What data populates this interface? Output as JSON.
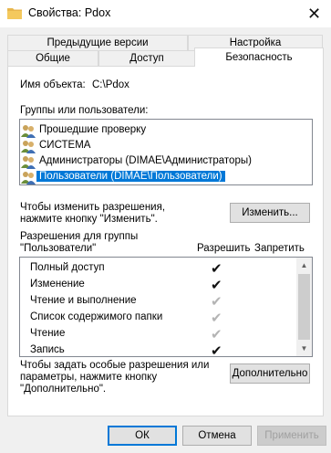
{
  "window": {
    "title": "Свойства: Pdox",
    "close_glyph": "✕"
  },
  "tabs": [
    {
      "label": "Предыдущие версии"
    },
    {
      "label": "Настройка"
    },
    {
      "label": "Общие"
    },
    {
      "label": "Доступ"
    },
    {
      "label": "Безопасность"
    }
  ],
  "object": {
    "label": "Имя объекта:",
    "value": "C:\\Pdox"
  },
  "groups": {
    "label": "Группы или пользователи:",
    "items": [
      {
        "label": "Прошедшие проверку",
        "selected": false
      },
      {
        "label": "СИСТЕМА",
        "selected": false
      },
      {
        "label": "Администраторы (DIMAE\\Администраторы)",
        "selected": false
      },
      {
        "label": "Пользователи (DIMAE\\Пользователи)",
        "selected": true
      }
    ]
  },
  "change": {
    "hint": "Чтобы изменить разрешения,\nнажмите кнопку \"Изменить\".",
    "button": "Изменить..."
  },
  "permissions": {
    "header": "Разрешения для группы\n\"Пользователи\"",
    "allow_header": "Разрешить",
    "deny_header": "Запретить",
    "rows": [
      {
        "label": "Полный доступ",
        "allow": true,
        "enabled": true
      },
      {
        "label": "Изменение",
        "allow": true,
        "enabled": true
      },
      {
        "label": "Чтение и выполнение",
        "allow": true,
        "enabled": false
      },
      {
        "label": "Список содержимого папки",
        "allow": true,
        "enabled": false
      },
      {
        "label": "Чтение",
        "allow": true,
        "enabled": false
      },
      {
        "label": "Запись",
        "allow": true,
        "enabled": true
      }
    ],
    "check_glyph": "✔"
  },
  "advanced": {
    "hint": "Чтобы задать особые разрешения или\nпараметры, нажмите кнопку\n\"Дополнительно\".",
    "button": "Дополнительно"
  },
  "footer": {
    "ok": "ОК",
    "cancel": "Отмена",
    "apply": "Применить"
  },
  "colors": {
    "selection": "#0078d7",
    "folder": "#e8b64c"
  }
}
